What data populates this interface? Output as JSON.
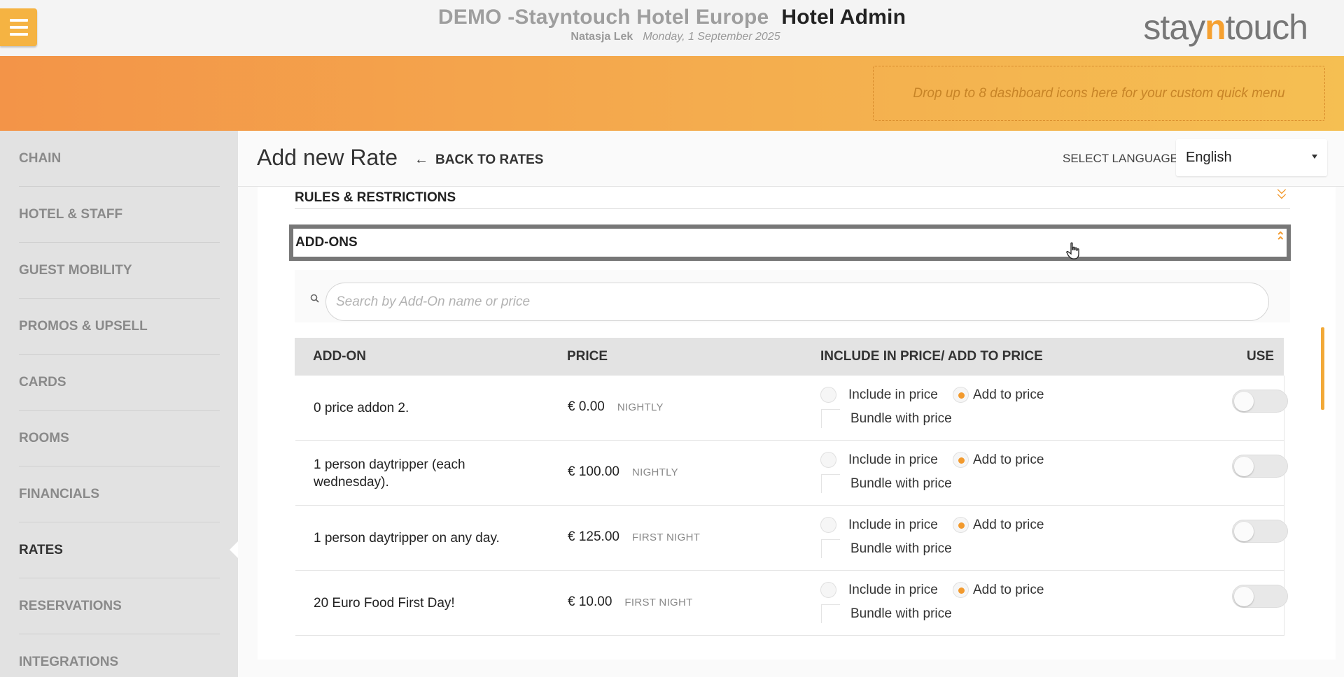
{
  "header": {
    "hotel_name": "DEMO -Stayntouch Hotel Europe",
    "app_name": "Hotel Admin",
    "user": "Natasja Lek",
    "date": "Monday, 1 September 2025",
    "logo_pre": "stay",
    "logo_n": "n",
    "logo_post": "touch"
  },
  "quick_menu": {
    "dropzone_text": "Drop up to 8 dashboard icons here for your custom quick menu"
  },
  "sidebar": {
    "items": [
      {
        "label": "CHAIN"
      },
      {
        "label": "HOTEL & STAFF"
      },
      {
        "label": "GUEST MOBILITY"
      },
      {
        "label": "PROMOS & UPSELL"
      },
      {
        "label": "CARDS"
      },
      {
        "label": "ROOMS"
      },
      {
        "label": "FINANCIALS"
      },
      {
        "label": "RATES",
        "active": true
      },
      {
        "label": "RESERVATIONS"
      },
      {
        "label": "INTEGRATIONS"
      }
    ]
  },
  "page": {
    "title": "Add new Rate",
    "back_label": "BACK TO RATES",
    "language_label": "SELECT LANGUAGE",
    "language_value": "English"
  },
  "sections": {
    "rules": "RULES & RESTRICTIONS",
    "addons": "ADD-ONS"
  },
  "search": {
    "placeholder": "Search by Add-On name or price",
    "value": ""
  },
  "table": {
    "headers": {
      "addon": "ADD-ON",
      "price": "PRICE",
      "include": "INCLUDE IN PRICE/ ADD TO PRICE",
      "use": "USE"
    },
    "option_labels": {
      "include": "Include in price",
      "add": "Add to price",
      "bundle": "Bundle with price"
    },
    "rows": [
      {
        "name": "0 price addon 2.",
        "price": "€ 0.00",
        "unit": "NIGHTLY",
        "selected": "add",
        "bundle": false,
        "use": false
      },
      {
        "name": "1 person daytripper (each wednesday).",
        "price": "€ 100.00",
        "unit": "NIGHTLY",
        "selected": "add",
        "bundle": false,
        "use": false
      },
      {
        "name": "1 person daytripper on any day.",
        "price": "€ 125.00",
        "unit": "FIRST NIGHT",
        "selected": "add",
        "bundle": false,
        "use": false
      },
      {
        "name": "20 Euro Food First Day!",
        "price": "€ 10.00",
        "unit": "FIRST NIGHT",
        "selected": "add",
        "bundle": false,
        "use": false
      }
    ]
  },
  "colors": {
    "accent": "#f29a2e",
    "band_start": "#f39448",
    "band_end": "#f5bf52",
    "sidebar_bg": "#e2e2e2"
  }
}
